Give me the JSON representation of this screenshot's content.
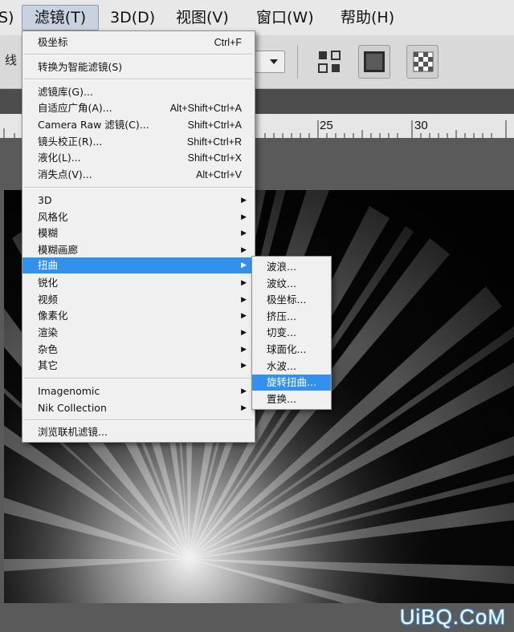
{
  "menubar": {
    "items": [
      {
        "label": "S)"
      },
      {
        "label": "滤镜(T)"
      },
      {
        "label": "3D(D)"
      },
      {
        "label": "视图(V)"
      },
      {
        "label": "窗口(W)"
      },
      {
        "label": "帮助(H)"
      }
    ]
  },
  "options_bar": {
    "partial_label": "线"
  },
  "ruler": {
    "labels": [
      "25",
      "30"
    ]
  },
  "filter_menu": {
    "items": [
      {
        "label": "极坐标",
        "shortcut": "Ctrl+F"
      },
      {
        "label": "转换为智能滤镜(S)",
        "shortcut": ""
      },
      {
        "label": "滤镜库(G)...",
        "shortcut": ""
      },
      {
        "label": "自适应广角(A)...",
        "shortcut": "Alt+Shift+Ctrl+A"
      },
      {
        "label": "Camera Raw 滤镜(C)...",
        "shortcut": "Shift+Ctrl+A"
      },
      {
        "label": "镜头校正(R)...",
        "shortcut": "Shift+Ctrl+R"
      },
      {
        "label": "液化(L)...",
        "shortcut": "Shift+Ctrl+X"
      },
      {
        "label": "消失点(V)...",
        "shortcut": "Alt+Ctrl+V"
      },
      {
        "label": "3D",
        "submenu": true
      },
      {
        "label": "风格化",
        "submenu": true
      },
      {
        "label": "模糊",
        "submenu": true
      },
      {
        "label": "模糊画廊",
        "submenu": true
      },
      {
        "label": "扭曲",
        "submenu": true,
        "highlighted": true
      },
      {
        "label": "锐化",
        "submenu": true
      },
      {
        "label": "视频",
        "submenu": true
      },
      {
        "label": "像素化",
        "submenu": true
      },
      {
        "label": "渲染",
        "submenu": true
      },
      {
        "label": "杂色",
        "submenu": true
      },
      {
        "label": "其它",
        "submenu": true
      },
      {
        "label": "Imagenomic",
        "submenu": true
      },
      {
        "label": "Nik Collection",
        "submenu": true
      },
      {
        "label": "浏览联机滤镜...",
        "shortcut": ""
      }
    ]
  },
  "distort_submenu": {
    "items": [
      {
        "label": "波浪..."
      },
      {
        "label": "波纹..."
      },
      {
        "label": "极坐标..."
      },
      {
        "label": "挤压..."
      },
      {
        "label": "切变..."
      },
      {
        "label": "球面化..."
      },
      {
        "label": "水波..."
      },
      {
        "label": "旋转扭曲...",
        "highlighted": true
      },
      {
        "label": "置换..."
      }
    ]
  },
  "watermark": "UiBQ.CoM",
  "colors": {
    "highlight": "#3391ee",
    "menu_bg": "#f0f0f0",
    "menubar_bg": "#e8e8e8"
  }
}
